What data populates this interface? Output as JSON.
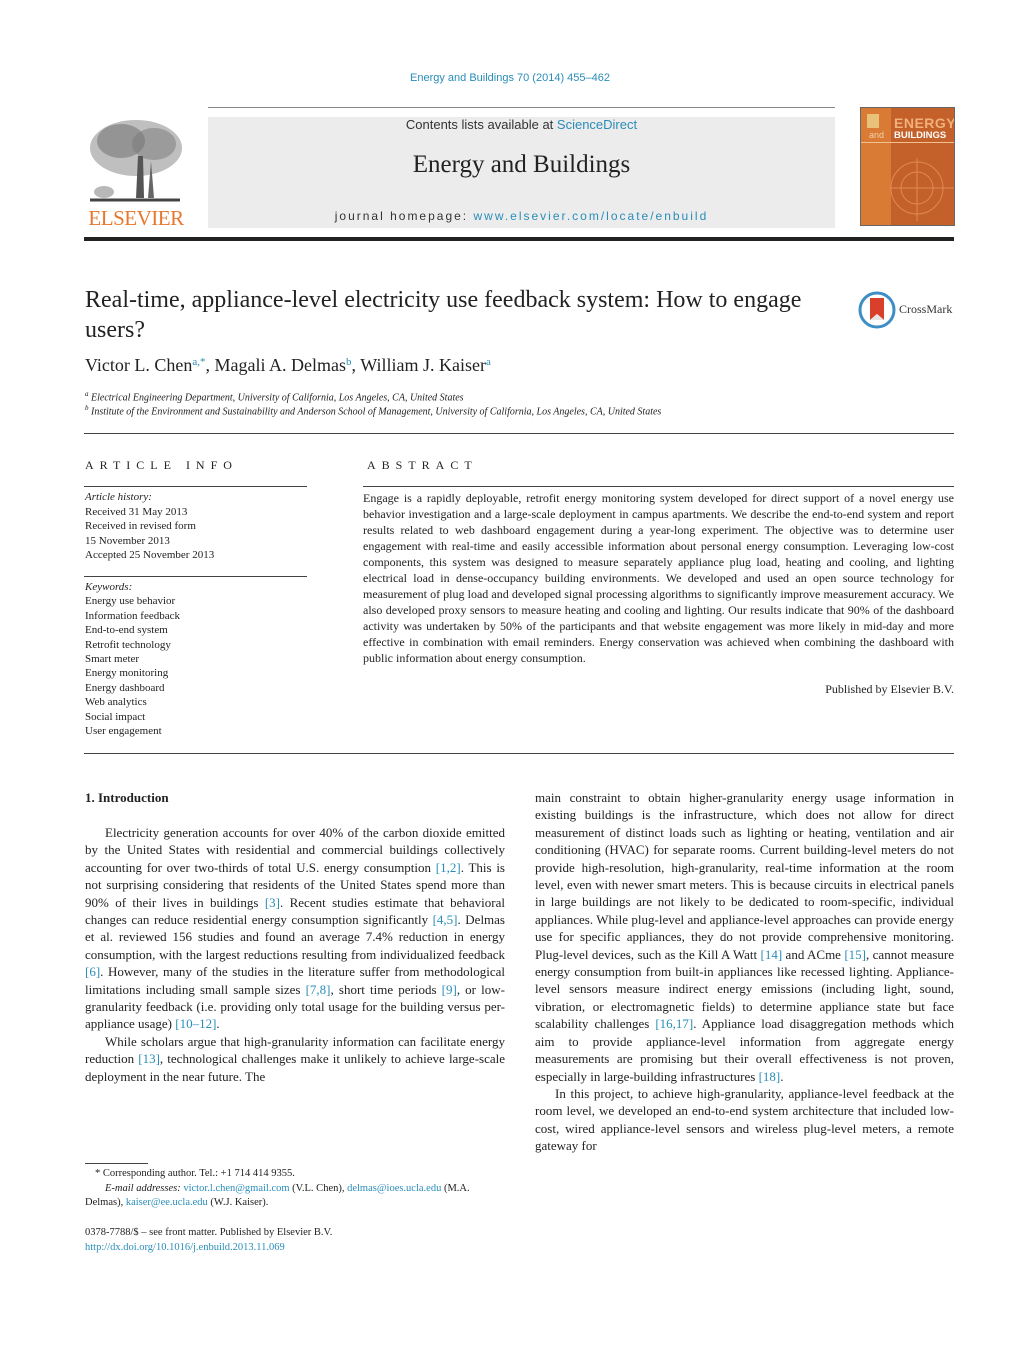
{
  "header": {
    "citation": "Energy and Buildings 70 (2014) 455–462",
    "contents_prefix": "Contents lists available at ",
    "contents_link": "ScienceDirect",
    "journal_title": "Energy and Buildings",
    "homepage_prefix": "journal homepage: ",
    "homepage_url": "www.elsevier.com/locate/enbuild",
    "publisher_logo": "ELSEVIER",
    "cover": {
      "line1": "ENERGY",
      "line2_small": "and",
      "line2": "BUILDINGS"
    },
    "crossmark_label": "CrossMark"
  },
  "article": {
    "title": "Real-time, appliance-level electricity use feedback system: How to engage users?",
    "authors": [
      {
        "name": "Victor L. Chen",
        "sup": "a,*"
      },
      {
        "name": "Magali A. Delmas",
        "sup": "b"
      },
      {
        "name": "William J. Kaiser",
        "sup": "a"
      }
    ],
    "affiliations": [
      {
        "key": "a",
        "text": "Electrical Engineering Department, University of California, Los Angeles, CA, United States"
      },
      {
        "key": "b",
        "text": "Institute of the Environment and Sustainability and Anderson School of Management, University of California, Los Angeles, CA, United States"
      }
    ]
  },
  "article_info": {
    "heading": "ARTICLE INFO",
    "history_label": "Article history:",
    "history": [
      "Received 31 May 2013",
      "Received in revised form",
      "15 November 2013",
      "Accepted 25 November 2013"
    ],
    "keywords_label": "Keywords:",
    "keywords": [
      "Energy use behavior",
      "Information feedback",
      "End-to-end system",
      "Retrofit technology",
      "Smart meter",
      "Energy monitoring",
      "Energy dashboard",
      "Web analytics",
      "Social impact",
      "User engagement"
    ]
  },
  "abstract": {
    "heading": "ABSTRACT",
    "text": "Engage is a rapidly deployable, retrofit energy monitoring system developed for direct support of a novel energy use behavior investigation and a large-scale deployment in campus apartments. We describe the end-to-end system and report results related to web dashboard engagement during a year-long experiment. The objective was to determine user engagement with real-time and easily accessible information about personal energy consumption. Leveraging low-cost components, this system was designed to measure separately appliance plug load, heating and cooling, and lighting electrical load in dense-occupancy building environments. We developed and used an open source technology for measurement of plug load and developed signal processing algorithms to significantly improve measurement accuracy. We also developed proxy sensors to measure heating and cooling and lighting. Our results indicate that 90% of the dashboard activity was undertaken by 50% of the participants and that website engagement was more likely in mid-day and more effective in combination with email reminders. Energy conservation was achieved when combining the dashboard with public information about energy consumption.",
    "published_by": "Published by Elsevier B.V."
  },
  "body": {
    "section_heading": "1.  Introduction",
    "left_paragraphs": [
      [
        {
          "t": "Electricity generation accounts for over 40% of the carbon dioxide emitted by the United States with residential and commercial buildings collectively accounting for over two-thirds of total U.S. energy consumption "
        },
        {
          "ref": "[1,2]"
        },
        {
          "t": ". This is not surprising considering that residents of the United States spend more than 90% of their lives in buildings "
        },
        {
          "ref": "[3]"
        },
        {
          "t": ". Recent studies estimate that behavioral changes can reduce residential energy consumption significantly "
        },
        {
          "ref": "[4,5]"
        },
        {
          "t": ". Delmas et al. reviewed 156 studies and found an average 7.4% reduction in energy consumption, with the largest reductions resulting from individualized feedback "
        },
        {
          "ref": "[6]"
        },
        {
          "t": ". However, many of the studies in the literature suffer from methodological limitations including small sample sizes "
        },
        {
          "ref": "[7,8]"
        },
        {
          "t": ", short time periods "
        },
        {
          "ref": "[9]"
        },
        {
          "t": ", or low-granularity feedback (i.e. providing only total usage for the building versus per-appliance usage) "
        },
        {
          "ref": "[10–12]"
        },
        {
          "t": "."
        }
      ],
      [
        {
          "t": "While scholars argue that high-granularity information can facilitate energy reduction "
        },
        {
          "ref": "[13]"
        },
        {
          "t": ", technological challenges make it unlikely to achieve large-scale deployment in the near future. The"
        }
      ]
    ],
    "right_paragraphs": [
      [
        {
          "t": "main constraint to obtain higher-granularity energy usage information in existing buildings is the infrastructure, which does not allow for direct measurement of distinct loads such as lighting or heating, ventilation and air conditioning (HVAC) for separate rooms. Current building-level meters do not provide high-resolution, high-granularity, real-time information at the room level, even with newer smart meters. This is because circuits in electrical panels in large buildings are not likely to be dedicated to room-specific, individual appliances. While plug-level and appliance-level approaches can provide energy use for specific appliances, they do not provide comprehensive monitoring. Plug-level devices, such as the Kill A Watt "
        },
        {
          "ref": "[14]"
        },
        {
          "t": " and ACme "
        },
        {
          "ref": "[15]"
        },
        {
          "t": ", cannot measure energy consumption from built-in appliances like recessed lighting. Appliance-level sensors measure indirect energy emissions (including light, sound, vibration, or electromagnetic fields) to determine appliance state but face scalability challenges "
        },
        {
          "ref": "[16,17]"
        },
        {
          "t": ". Appliance load disaggregation methods which aim to provide appliance-level information from aggregate energy measurements are promising but their overall effectiveness is not proven, especially in large-building infrastructures "
        },
        {
          "ref": "[18]"
        },
        {
          "t": "."
        }
      ],
      [
        {
          "t": "In this project, to achieve high-granularity, appliance-level feedback at the room level, we developed an end-to-end system architecture that included low-cost, wired appliance-level sensors and wireless plug-level meters, a remote gateway for"
        }
      ]
    ]
  },
  "footnotes": {
    "corresponding": "* Corresponding author. Tel.: +1 714 414 9355.",
    "email_label": "E-mail addresses:",
    "emails": [
      {
        "address": "victor.l.chen@gmail.com",
        "owner": " (V.L. Chen), "
      },
      {
        "address": "delmas@ioes.ucla.edu",
        "owner": " (M.A. Delmas), "
      },
      {
        "address": "kaiser@ee.ucla.edu",
        "owner": " (W.J. Kaiser)."
      }
    ],
    "front_matter": "0378-7788/$ – see front matter. Published by Elsevier B.V.",
    "doi": "http://dx.doi.org/10.1016/j.enbuild.2013.11.069"
  },
  "colors": {
    "link": "#2a8db8",
    "elsevier_orange": "#e8772e",
    "cover_orange": "#c4602a",
    "header_band": "#ececec"
  }
}
